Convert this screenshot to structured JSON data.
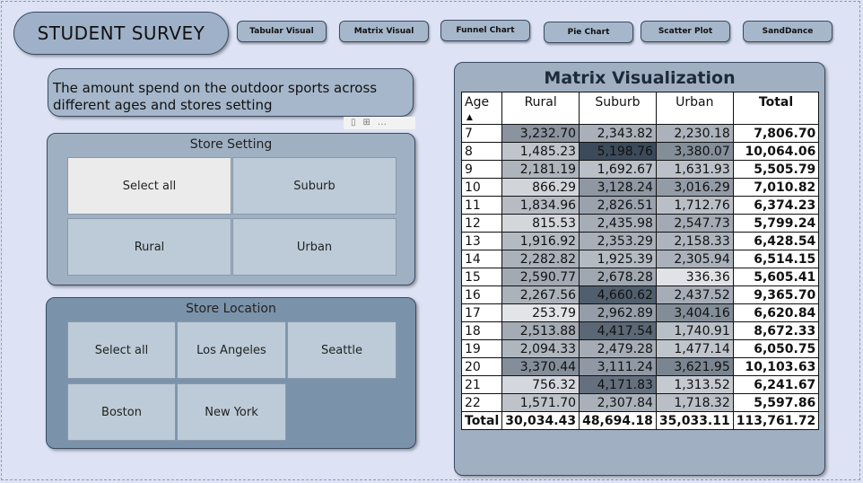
{
  "header": {
    "title": "STUDENT SURVEY",
    "nav": [
      "Tabular Visual",
      "Matrix Visual",
      "Funnel Chart",
      "Pie Chart",
      "Scatter Plot",
      "SandDance"
    ]
  },
  "description": "The amount spend on the outdoor sports across different ages and stores setting",
  "store_setting": {
    "title": "Store Setting",
    "options": [
      "Select all",
      "Suburb",
      "Rural",
      "Urban"
    ],
    "selected": "Select all"
  },
  "store_location": {
    "title": "Store Location",
    "options": [
      "Select all",
      "Los Angeles",
      "Seattle",
      "Boston",
      "New York"
    ]
  },
  "matrix": {
    "title": "Matrix Visualization",
    "columns": [
      "Age",
      "Rural",
      "Suburb",
      "Urban",
      "Total"
    ],
    "rows": [
      {
        "age": "7",
        "rural": "3,232.70",
        "suburb": "2,343.82",
        "urban": "2,230.18",
        "total": "7,806.70"
      },
      {
        "age": "8",
        "rural": "1,485.23",
        "suburb": "5,198.76",
        "urban": "3,380.07",
        "total": "10,064.06"
      },
      {
        "age": "9",
        "rural": "2,181.19",
        "suburb": "1,692.67",
        "urban": "1,631.93",
        "total": "5,505.79"
      },
      {
        "age": "10",
        "rural": "866.29",
        "suburb": "3,128.24",
        "urban": "3,016.29",
        "total": "7,010.82"
      },
      {
        "age": "11",
        "rural": "1,834.96",
        "suburb": "2,826.51",
        "urban": "1,712.76",
        "total": "6,374.23"
      },
      {
        "age": "12",
        "rural": "815.53",
        "suburb": "2,435.98",
        "urban": "2,547.73",
        "total": "5,799.24"
      },
      {
        "age": "13",
        "rural": "1,916.92",
        "suburb": "2,353.29",
        "urban": "2,158.33",
        "total": "6,428.54"
      },
      {
        "age": "14",
        "rural": "2,282.82",
        "suburb": "1,925.39",
        "urban": "2,305.94",
        "total": "6,514.15"
      },
      {
        "age": "15",
        "rural": "2,590.77",
        "suburb": "2,678.28",
        "urban": "336.36",
        "total": "5,605.41"
      },
      {
        "age": "16",
        "rural": "2,267.56",
        "suburb": "4,660.62",
        "urban": "2,437.52",
        "total": "9,365.70"
      },
      {
        "age": "17",
        "rural": "253.79",
        "suburb": "2,962.89",
        "urban": "3,404.16",
        "total": "6,620.84"
      },
      {
        "age": "18",
        "rural": "2,513.88",
        "suburb": "4,417.54",
        "urban": "1,740.91",
        "total": "8,672.33"
      },
      {
        "age": "19",
        "rural": "2,094.33",
        "suburb": "2,479.28",
        "urban": "1,477.14",
        "total": "6,050.75"
      },
      {
        "age": "20",
        "rural": "3,370.44",
        "suburb": "3,111.24",
        "urban": "3,621.95",
        "total": "10,103.63"
      },
      {
        "age": "21",
        "rural": "756.32",
        "suburb": "4,171.83",
        "urban": "1,313.52",
        "total": "6,241.67"
      },
      {
        "age": "22",
        "rural": "1,571.70",
        "suburb": "2,307.84",
        "urban": "1,718.32",
        "total": "5,597.86"
      }
    ],
    "totals": {
      "label": "Total",
      "rural": "30,034.43",
      "suburb": "48,694.18",
      "urban": "35,033.11",
      "total": "113,761.72"
    }
  }
}
